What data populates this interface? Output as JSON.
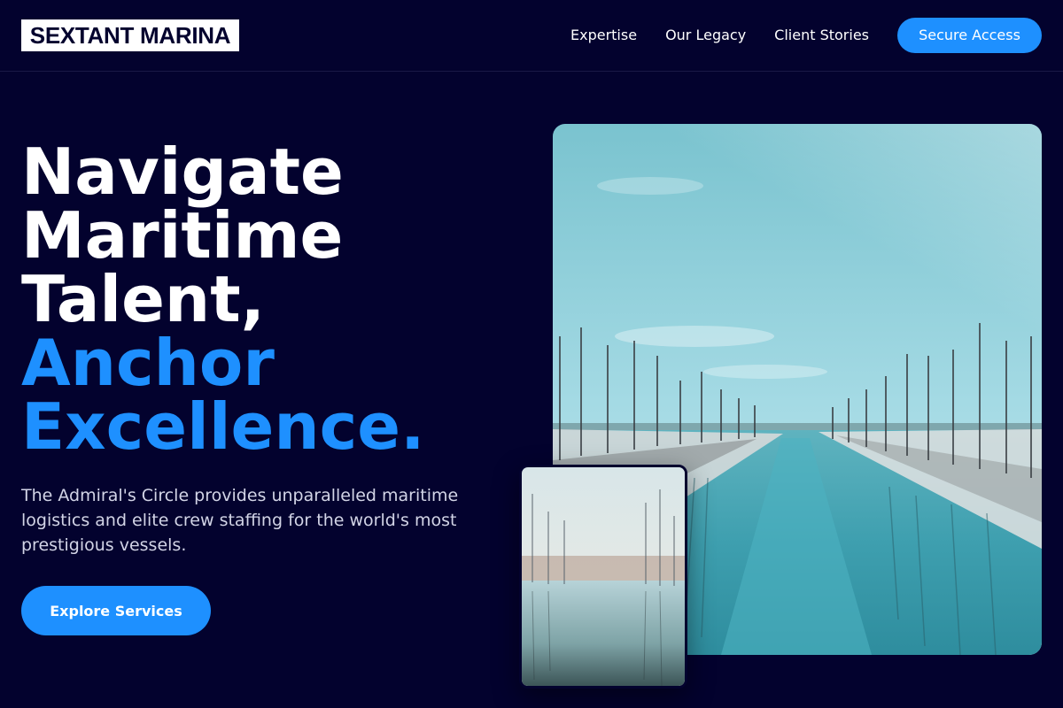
{
  "brand": {
    "logo_text": "SEXTANT MARINA"
  },
  "nav": {
    "links": [
      "Expertise",
      "Our Legacy",
      "Client Stories"
    ],
    "cta_label": "Secure Access"
  },
  "hero": {
    "headline_lines": [
      "Navigate",
      "Maritime",
      "Talent,"
    ],
    "headline_accent_lines": [
      "Anchor",
      "Excellence."
    ],
    "description": "The Admiral's Circle provides unparalleled maritime logistics and elite crew staffing for the world's most prestigious vessels.",
    "button_label": "Explore Services"
  },
  "images": {
    "main": "marina-photo",
    "inset": "harbor-reflection-photo"
  },
  "colors": {
    "background": "#03022e",
    "accent": "#1e90ff",
    "text": "#ffffff",
    "muted_text": "#d2d4e6"
  }
}
